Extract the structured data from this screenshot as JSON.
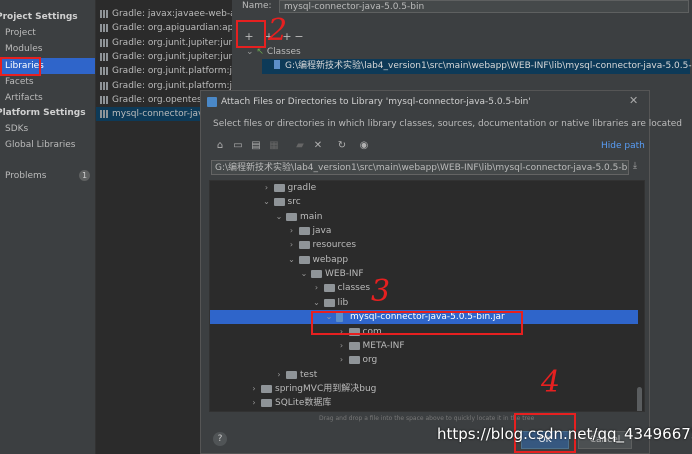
{
  "nav": {
    "project_settings": "Project Settings",
    "items_project": [
      "Project",
      "Modules",
      "Libraries",
      "Facets",
      "Artifacts"
    ],
    "platform_settings": "Platform Settings",
    "items_platform": [
      "SDKs",
      "Global Libraries"
    ],
    "problems": "Problems",
    "problems_count": "1",
    "selected": "Libraries"
  },
  "libraries": [
    "Gradle: javax:javaee-web-api:8.0",
    "Gradle: org.apiguardian:apiguardian",
    "Gradle: org.junit.jupiter:junit-jupiter",
    "Gradle: org.junit.jupiter:junit-jupiter",
    "Gradle: org.junit.platform:junit-platform",
    "Gradle: org.junit.platform:junit-platform",
    "Gradle: org.opentest4j",
    "mysql-connector-java-5.0.5-bin"
  ],
  "library_detail": {
    "name_label": "Name:",
    "name_value": "mysql-connector-java-5.0.5-bin",
    "classes_label": "Classes",
    "classes_path": "G:\\编程新技术实验\\lab4_version1\\src\\main\\webapp\\WEB-INF\\lib\\mysql-connector-java-5.0.5-bin.jar"
  },
  "dialog": {
    "title": "Attach Files or Directories to Library 'mysql-connector-java-5.0.5-bin'",
    "description": "Select files or directories in which library classes, sources, documentation or native libraries are located",
    "hide_path": "Hide path",
    "path_value": "G:\\编程新技术实验\\lab4_version1\\src\\main\\webapp\\WEB-INF\\lib\\mysql-connector-java-5.0.5-bin.jar",
    "tree": [
      {
        "label": "gradle",
        "depth": 3,
        "arrow": "›",
        "kind": "folder"
      },
      {
        "label": "src",
        "depth": 3,
        "arrow": "⌄",
        "kind": "folder"
      },
      {
        "label": "main",
        "depth": 4,
        "arrow": "⌄",
        "kind": "folder"
      },
      {
        "label": "java",
        "depth": 5,
        "arrow": "›",
        "kind": "folder"
      },
      {
        "label": "resources",
        "depth": 5,
        "arrow": "›",
        "kind": "folder"
      },
      {
        "label": "webapp",
        "depth": 5,
        "arrow": "⌄",
        "kind": "folder"
      },
      {
        "label": "WEB-INF",
        "depth": 6,
        "arrow": "⌄",
        "kind": "folder"
      },
      {
        "label": "classes",
        "depth": 7,
        "arrow": "›",
        "kind": "folder"
      },
      {
        "label": "lib",
        "depth": 7,
        "arrow": "⌄",
        "kind": "folder"
      },
      {
        "label": "mysql-connector-java-5.0.5-bin.jar",
        "depth": 8,
        "arrow": "⌄",
        "kind": "jar",
        "selected": true
      },
      {
        "label": "com",
        "depth": 9,
        "arrow": "›",
        "kind": "folder"
      },
      {
        "label": "META-INF",
        "depth": 9,
        "arrow": "›",
        "kind": "folder"
      },
      {
        "label": "org",
        "depth": 9,
        "arrow": "›",
        "kind": "folder"
      },
      {
        "label": "test",
        "depth": 4,
        "arrow": "›",
        "kind": "folder"
      },
      {
        "label": "springMVC用到解决bug",
        "depth": 2,
        "arrow": "›",
        "kind": "folder"
      },
      {
        "label": "SQLite数据库",
        "depth": 2,
        "arrow": "›",
        "kind": "folder"
      }
    ],
    "dnd_hint": "Drag and drop a file into the space above to quickly locate it in the tree",
    "help": "?",
    "ok": "OK",
    "cancel": "Cancel"
  },
  "annotations": {
    "step2": "2",
    "step3": "3",
    "step4": "4"
  },
  "watermark": "https://blog.csdn.net/qq_43496675",
  "colors": {
    "selection": "#2f65ca",
    "annotation": "#e62020",
    "link": "#589df6"
  }
}
